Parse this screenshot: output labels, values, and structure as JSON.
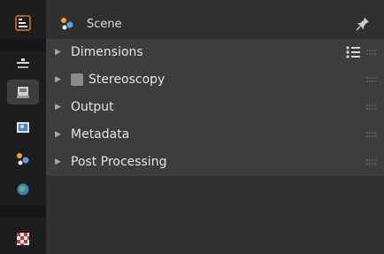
{
  "header": {
    "title": "Scene"
  },
  "sections": [
    {
      "label": "Dimensions",
      "has_checkbox": false,
      "has_presets": true
    },
    {
      "label": "Stereoscopy",
      "has_checkbox": true,
      "checked": false,
      "has_presets": false
    },
    {
      "label": "Output",
      "has_checkbox": false,
      "has_presets": false
    },
    {
      "label": "Metadata",
      "has_checkbox": false,
      "has_presets": false
    },
    {
      "label": "Post Processing",
      "has_checkbox": false,
      "has_presets": false
    }
  ],
  "sidebar_tabs": [
    {
      "icon": "tool-icon"
    },
    {
      "icon": "render-icon"
    },
    {
      "icon": "output-icon",
      "active": true
    },
    {
      "icon": "view-layer-icon"
    },
    {
      "icon": "scene-icon"
    },
    {
      "icon": "world-icon"
    },
    {
      "icon": "texture-icon"
    }
  ],
  "colors": {
    "panel_bg": "#303030",
    "section_bg": "#3d3d3d",
    "tab_strip": "#1d1d1d",
    "text": "#e3e3e3"
  }
}
